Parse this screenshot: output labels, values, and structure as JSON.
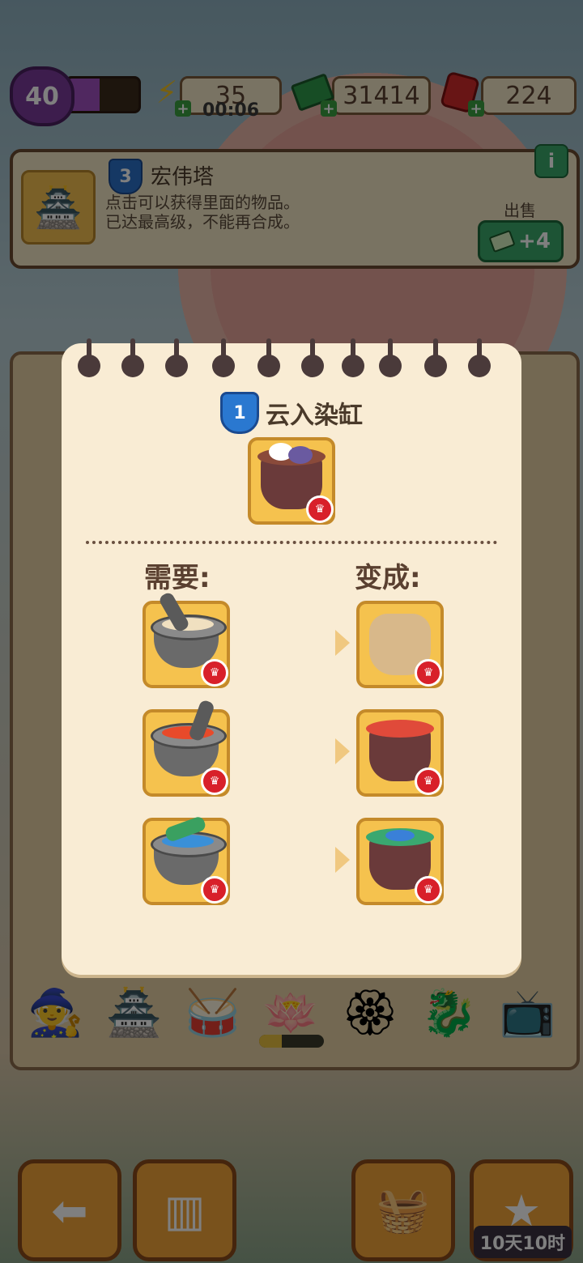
{
  "top_bar": {
    "level": "40",
    "energy": "35",
    "energy_timer": "00:06",
    "cash": "31414",
    "gems": "224"
  },
  "info_panel": {
    "level_badge": "3",
    "item_name": "宏伟塔",
    "desc_line1": "点击可以获得里面的物品。",
    "desc_line2": "已达最高级，不能再合成。",
    "info_button": "i",
    "sell_label": "出售",
    "sell_value": "+4"
  },
  "modal": {
    "level_badge": "1",
    "title": "云入染缸",
    "need_label": "需要:",
    "become_label": "变成:"
  },
  "bottom_bar": {
    "timer": "10天10时"
  },
  "colors": {
    "accent_green": "#3aa86a",
    "badge_blue": "#2a78d0",
    "crown_red": "#d8202a",
    "tile_gold": "#f5c24e"
  }
}
